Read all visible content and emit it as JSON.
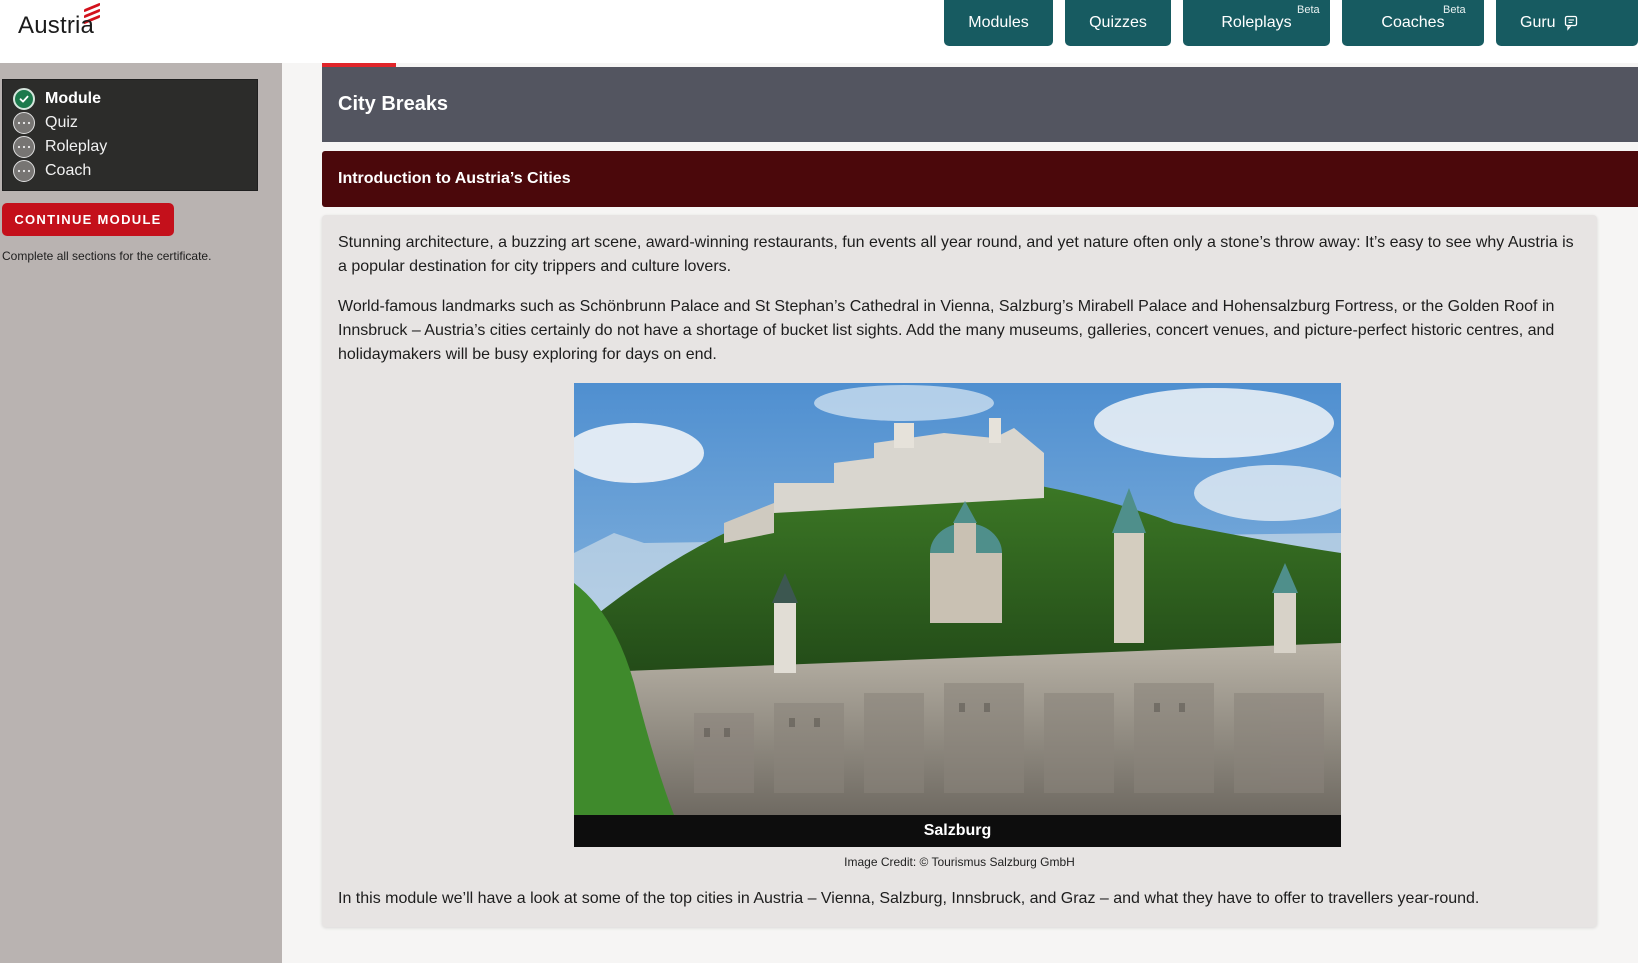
{
  "brand": {
    "logo_text": "Austria",
    "accent": "#d3111c"
  },
  "nav": {
    "items": [
      {
        "label": "Modules",
        "badge": ""
      },
      {
        "label": "Quizzes",
        "badge": ""
      },
      {
        "label": "Roleplays",
        "badge": "Beta"
      },
      {
        "label": "Coaches",
        "badge": "Beta"
      },
      {
        "label": "Guru",
        "badge": "",
        "icon": "chat-icon"
      }
    ],
    "color": "#175b61"
  },
  "sidebar": {
    "steps": [
      {
        "label": "Module",
        "status": "completed",
        "icon": "check-circle-icon"
      },
      {
        "label": "Quiz",
        "status": "pending",
        "icon": "ellipsis-circle-icon"
      },
      {
        "label": "Roleplay",
        "status": "pending",
        "icon": "ellipsis-circle-icon"
      },
      {
        "label": "Coach",
        "status": "pending",
        "icon": "ellipsis-circle-icon"
      }
    ],
    "continue_label": "CONTINUE MODULE",
    "note": "Complete all sections for the certificate."
  },
  "module": {
    "title": "City Breaks",
    "section_title": "Introduction to Austria’s Cities",
    "paragraphs": [
      "Stunning architecture, a buzzing art scene, award-winning restaurants, fun events all year round, and yet nature often only a stone’s throw away: It’s easy to see why Austria is a popular destination for city trippers and culture lovers.",
      "World-famous landmarks such as Schönbrunn Palace and St Stephan’s Cathedral in Vienna, Salzburg’s Mirabell Palace and Hohensalzburg Fortress, or the Golden Roof in Innsbruck – Austria’s cities certainly do not have a shortage of bucket list sights. Add the many museums, galleries, concert venues, and picture-perfect historic centres, and holidaymakers will be busy exploring for days on end."
    ],
    "image_caption": "Salzburg",
    "image_credit": "Image Credit: © Tourismus Salzburg GmbH",
    "summary": "In this module we’ll have a look at some of the top cities in Austria – Vienna, Salzburg, Innsbruck, and Graz – and what they have to offer to travellers year-round."
  },
  "colors": {
    "header_bg": "#ffffff",
    "sidebar_bg": "#b9b3b1",
    "module_head": "#535560",
    "section_head": "#4b080b",
    "cta_red": "#c4101b"
  }
}
